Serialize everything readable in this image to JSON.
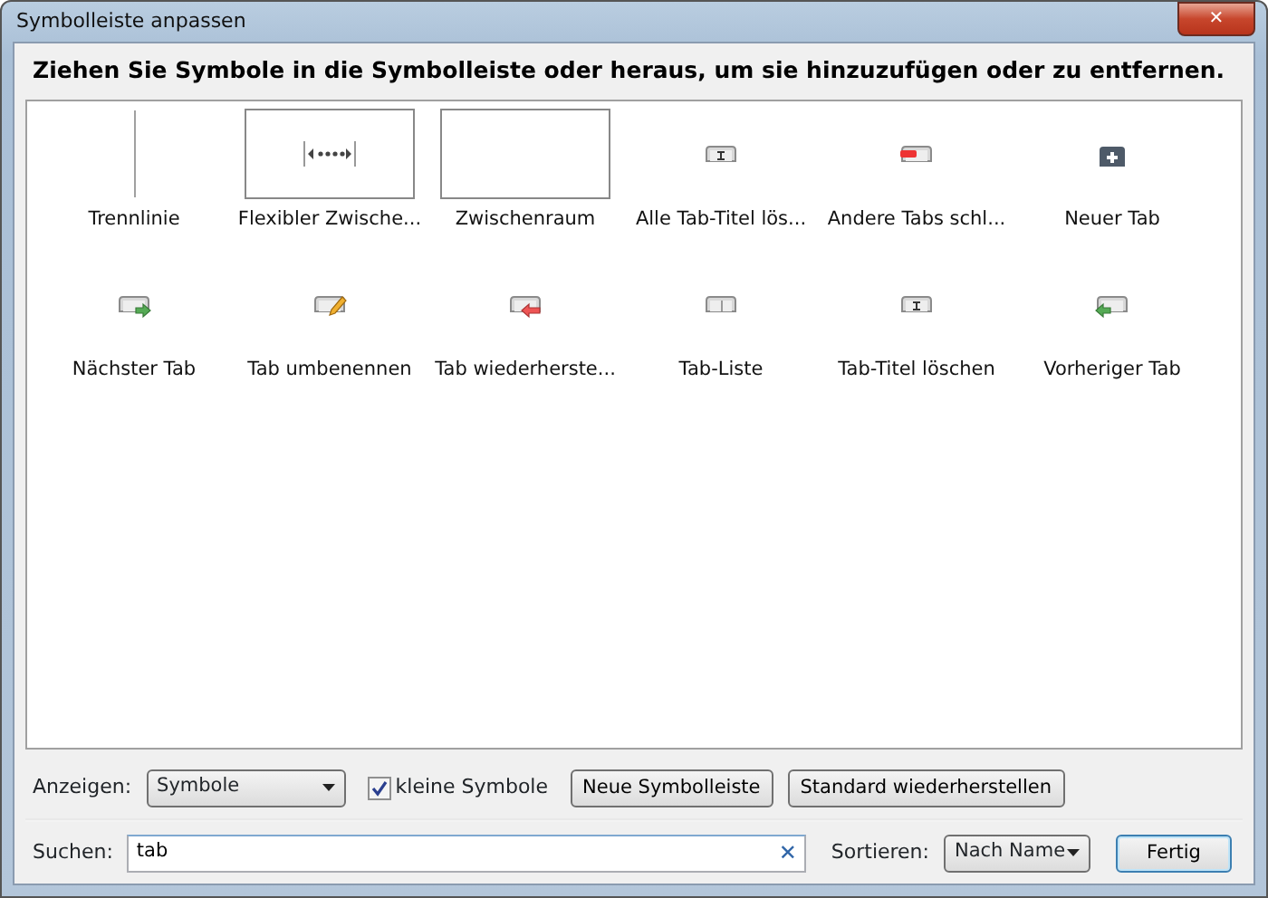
{
  "window": {
    "title": "Symbolleiste anpassen",
    "close": "✕"
  },
  "instruction": "Ziehen Sie Symbole in die Symbolleiste oder heraus, um sie hinzuzufügen oder zu entfernen.",
  "items": [
    {
      "kind": "separator",
      "label": "Trennlinie"
    },
    {
      "kind": "flexible-space",
      "label": "Flexibler Zwische..."
    },
    {
      "kind": "space",
      "label": "Zwischenraum"
    },
    {
      "kind": "button",
      "label": "Alle Tab-Titel lös..."
    },
    {
      "kind": "button",
      "label": "Andere Tabs schl..."
    },
    {
      "kind": "button",
      "label": "Neuer Tab"
    },
    {
      "kind": "button",
      "label": "Nächster Tab"
    },
    {
      "kind": "button",
      "label": "Tab umbenennen"
    },
    {
      "kind": "button",
      "label": "Tab wiederherste..."
    },
    {
      "kind": "button",
      "label": "Tab-Liste"
    },
    {
      "kind": "button",
      "label": "Tab-Titel löschen"
    },
    {
      "kind": "button",
      "label": "Vorheriger Tab"
    }
  ],
  "show": {
    "label": "Anzeigen:",
    "value": "Symbole"
  },
  "small_icons": {
    "label": "kleine Symbole",
    "checked": true
  },
  "buttons": [
    "Neue Symbolleiste",
    "Standard wiederherstellen"
  ],
  "search": {
    "label": "Suchen:",
    "value": "tab",
    "clear": "✕"
  },
  "sort": {
    "label": "Sortieren:",
    "value": "Nach Name"
  },
  "done": "Fertig"
}
